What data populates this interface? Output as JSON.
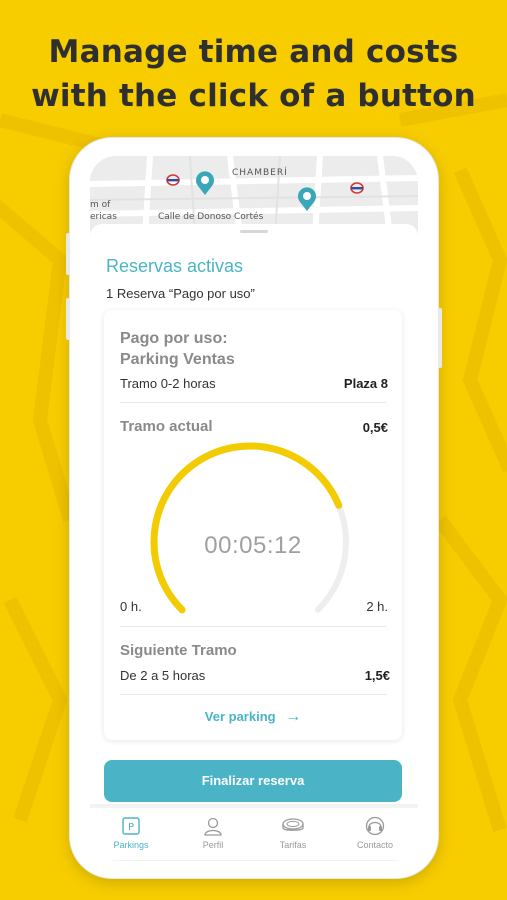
{
  "headline": {
    "line1": "Manage time and costs",
    "line2": "with the click of a button"
  },
  "map": {
    "district": "CHAMBERÍ",
    "street": "Calle de Donoso Cortés",
    "left_label_1": "m of",
    "left_label_2": "ericas"
  },
  "reservas": {
    "title": "Reservas activas",
    "subtitle": "1 Reserva “Pago por uso”"
  },
  "card": {
    "title_line1": "Pago por uso:",
    "title_line2": "Parking Ventas",
    "tramo": "Tramo 0-2 horas",
    "plaza": "Plaza 8",
    "tramo_actual_label": "Tramo actual",
    "tramo_actual_price": "0,5€",
    "timer": "00:05:12",
    "progress_fraction": 0.75,
    "gauge_start_label": "0 h.",
    "gauge_end_label": "2 h.",
    "siguiente_label": "Siguiente Tramo",
    "siguiente_range": "De 2 a 5 horas",
    "siguiente_price": "1,5€",
    "ver_parking": "Ver parking",
    "arrow": "→"
  },
  "actions": {
    "finalizar": "Finalizar reserva"
  },
  "tabs": [
    {
      "label": "Parkings",
      "icon": "parking-icon",
      "active": true
    },
    {
      "label": "Perfil",
      "icon": "user-icon",
      "active": false
    },
    {
      "label": "Tarifas",
      "icon": "coins-icon",
      "active": false
    },
    {
      "label": "Contacto",
      "icon": "headset-icon",
      "active": false
    }
  ],
  "colors": {
    "background": "#f7cd00",
    "accent": "#4ab4c6",
    "gauge": "#f2cb00",
    "gauge_track": "#eeeeee"
  }
}
